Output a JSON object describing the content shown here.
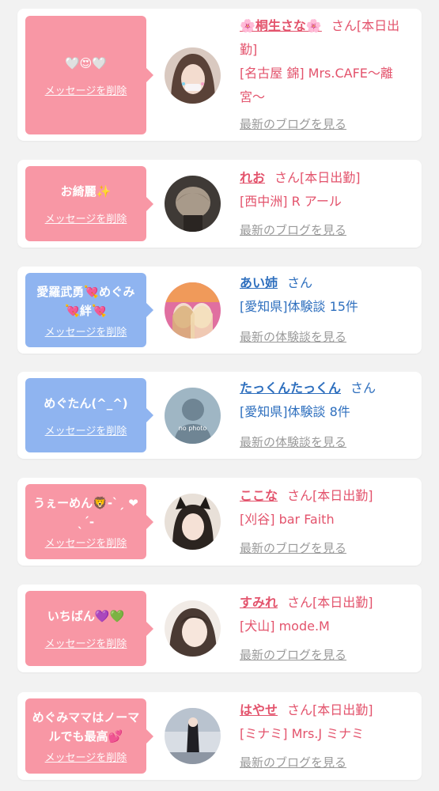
{
  "colors": {
    "page_bg": "#f2f2f2",
    "pink_bubble": "#f897a5",
    "blue_bubble": "#8fb4f0",
    "pink_text": "#e3536c",
    "blue_text": "#2e6fbe",
    "link_gray": "#9a9a9a"
  },
  "delete_label": "メッセージを削除",
  "cards": [
    {
      "bubble_color": "pink",
      "message": "🤍😍🤍",
      "avatar": "girl-photo",
      "name": "🌸桐生さな🌸",
      "honorific": "さん",
      "status": "[本日出勤]",
      "detail": "[名古屋 錦] Mrs.CAFE〜離宮〜",
      "link": "最新のブログを見る"
    },
    {
      "bubble_color": "pink",
      "message": "お綺麗✨",
      "avatar": "hair-photo",
      "name": "れお",
      "honorific": "さん",
      "status": "[本日出勤]",
      "detail": "[西中洲] R アール",
      "link": "最新のブログを見る"
    },
    {
      "bubble_color": "blue",
      "message": "愛羅武勇💘めぐみ💘絆💘",
      "avatar": "duo-photo",
      "name": "あい姉",
      "honorific": "さん",
      "status": "",
      "detail": "[愛知県]体験談 15件",
      "link": "最新の体験談を見る"
    },
    {
      "bubble_color": "blue",
      "message": "めぐたん(^_^)",
      "avatar": "no-photo",
      "avatar_text": "no photo",
      "name": "たっくんたっくん",
      "honorific": "さん",
      "status": "",
      "detail": "[愛知県]体験談 8件",
      "link": "最新の体験談を見る"
    },
    {
      "bubble_color": "pink",
      "message": "うぇーめん🦁-ˋˏ ❤︎ ˎˊ-",
      "avatar": "cat-ear-photo",
      "name": "ここな",
      "honorific": "さん",
      "status": "[本日出勤]",
      "detail": "[刈谷] bar Faith",
      "link": "最新のブログを見る"
    },
    {
      "bubble_color": "pink",
      "message": "いちばん💜💚",
      "avatar": "face-photo",
      "name": "すみれ",
      "honorific": "さん",
      "status": "[本日出勤]",
      "detail": "[犬山] mode.M",
      "link": "最新のブログを見る"
    },
    {
      "bubble_color": "pink",
      "message": "めぐみママはノーマルでも最高💕",
      "avatar": "room-photo",
      "name": "はやせ",
      "honorific": "さん",
      "status": "[本日出勤]",
      "detail": "[ミナミ] Mrs.J ミナミ",
      "link": "最新のブログを見る"
    }
  ]
}
